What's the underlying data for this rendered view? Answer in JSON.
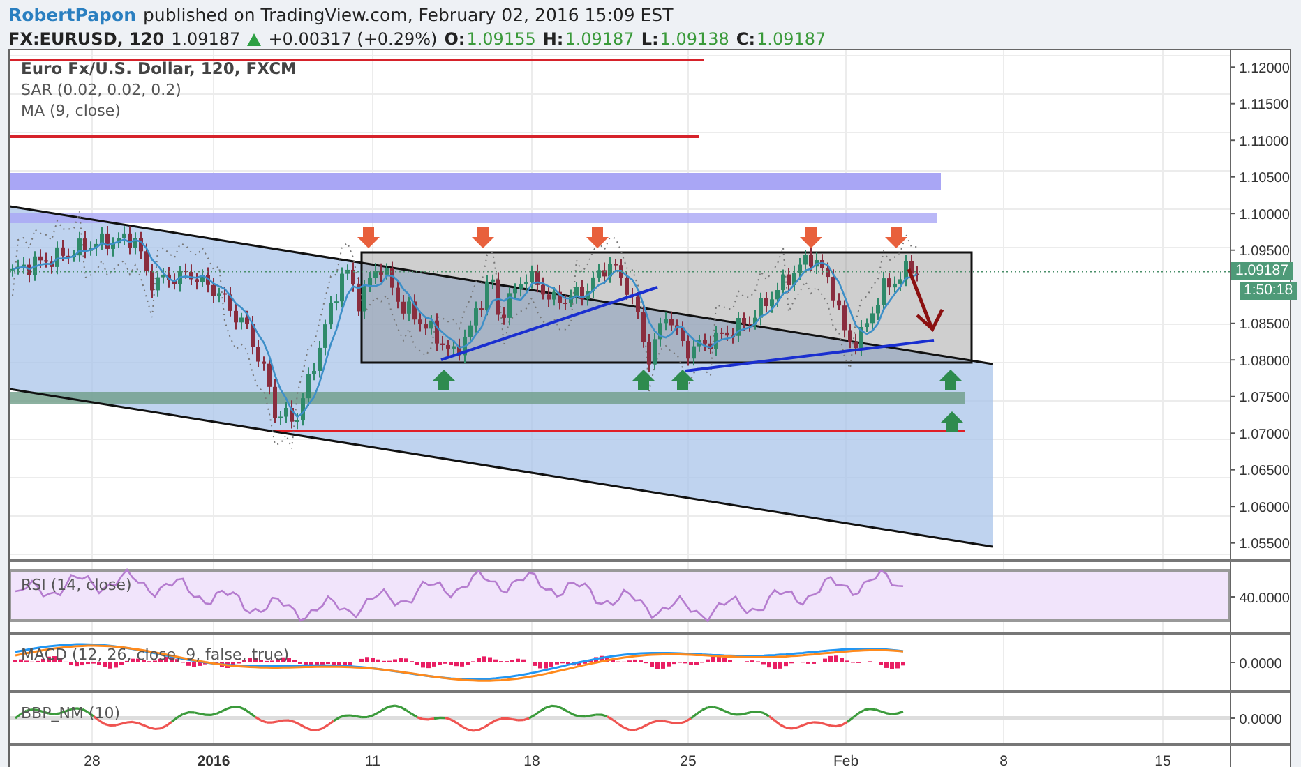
{
  "header": {
    "author": "RobertPapon",
    "published": "published on TradingView.com, February 02, 2016 15:09 EST"
  },
  "quote": {
    "symbol": "FX:EURUSD, 120",
    "last": "1.09187",
    "rising": true,
    "change": "+0.00317 (+0.29%)",
    "ohlc": [
      {
        "label": "O:",
        "value": "1.09155"
      },
      {
        "label": "H:",
        "value": "1.09187"
      },
      {
        "label": "L:",
        "value": "1.09138"
      },
      {
        "label": "C:",
        "value": "1.09187"
      }
    ]
  },
  "chart": {
    "legend": {
      "title": "Euro Fx/U.S. Dollar, 120, FXCM",
      "studies": [
        "SAR (0.02, 0.02, 0.2)",
        "MA (9, close)"
      ]
    },
    "price_axis": [
      "1.12000",
      "1.11500",
      "1.11000",
      "1.10500",
      "1.10000",
      "1.09500",
      "1.08500",
      "1.08000",
      "1.07500",
      "1.07000",
      "1.06500",
      "1.06000",
      "1.05500"
    ],
    "last_price": "1.09187",
    "countdown": "1:50:18",
    "panes": [
      {
        "kind": "rsi",
        "label": "RSI (14, close)",
        "axis_label": "40.0000"
      },
      {
        "kind": "macd",
        "label": "MACD (12, 26, close, 9, false, true)",
        "axis_label": "0.0000"
      },
      {
        "kind": "bbp",
        "label": "BBP_NM (10)",
        "axis_label": "0.0000"
      }
    ],
    "time_axis": [
      {
        "label": "28",
        "major": false
      },
      {
        "label": "2016",
        "major": true
      },
      {
        "label": "11",
        "major": false
      },
      {
        "label": "18",
        "major": false
      },
      {
        "label": "25",
        "major": false
      },
      {
        "label": "Feb",
        "major": false
      },
      {
        "label": "8",
        "major": false
      },
      {
        "label": "15",
        "major": false
      }
    ]
  }
}
